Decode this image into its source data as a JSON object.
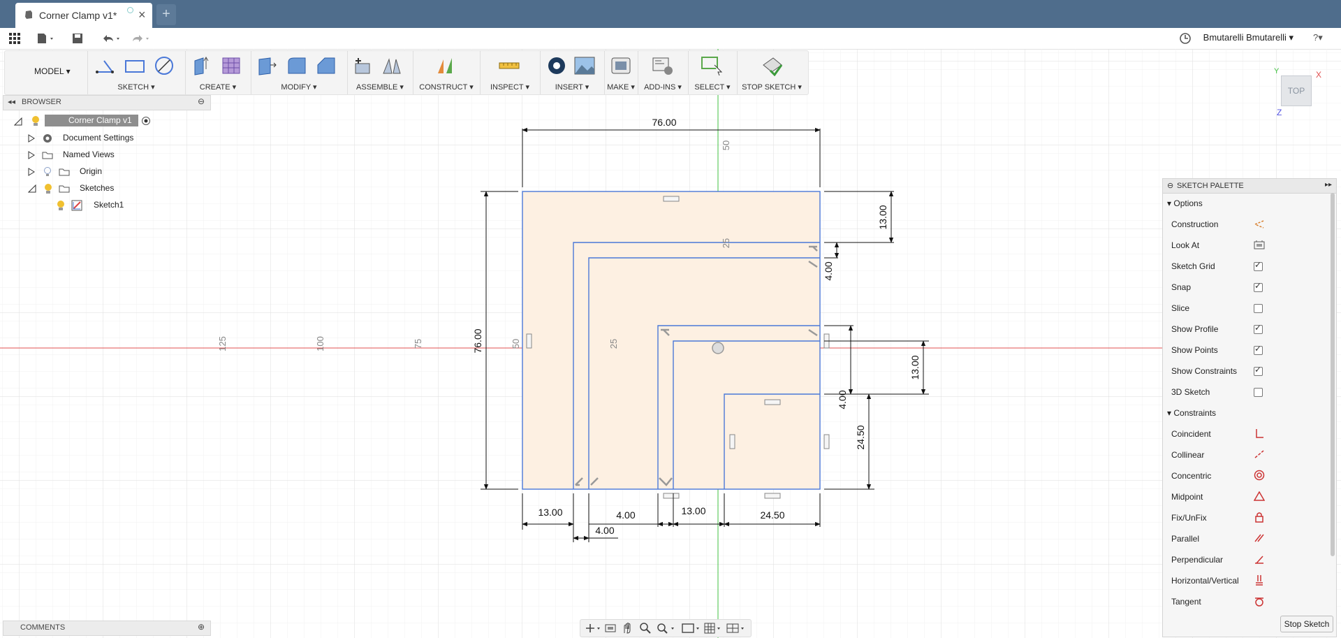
{
  "tab": {
    "title": "Corner Clamp v1*",
    "new_tab": "+"
  },
  "user": {
    "name": "Bmutarelli Bmutarelli ▾",
    "help": "?▾"
  },
  "toolbar": {
    "workspace": "MODEL ▾",
    "groups": [
      "SKETCH ▾",
      "CREATE ▾",
      "MODIFY ▾",
      "ASSEMBLE ▾",
      "CONSTRUCT ▾",
      "INSPECT ▾",
      "INSERT ▾",
      "MAKE ▾",
      "ADD-INS ▾",
      "SELECT ▾",
      "STOP SKETCH ▾"
    ]
  },
  "browser": {
    "title": "BROWSER",
    "root": "Corner Clamp v1",
    "items": [
      "Document Settings",
      "Named Views",
      "Origin",
      "Sketches",
      "Sketch1"
    ]
  },
  "viewcube": {
    "face": "TOP",
    "x": "X",
    "y": "Y",
    "z": "Z"
  },
  "canvas": {
    "axis_numbers": [
      "125",
      "100",
      "75",
      "50",
      "25",
      "50",
      "25"
    ],
    "dimensions": [
      "76.00",
      "76.00",
      "13.00",
      "4.00",
      "13.00",
      "4.00",
      "24.50",
      "13.00",
      "4.00",
      "4.00",
      "13.00",
      "24.50"
    ]
  },
  "palette": {
    "title": "SKETCH PALETTE",
    "options_header": "Options",
    "options": [
      {
        "label": "Construction",
        "checked": null,
        "icon": "construction-icon"
      },
      {
        "label": "Look At",
        "checked": null,
        "icon": "look-at-icon"
      },
      {
        "label": "Sketch Grid",
        "checked": true
      },
      {
        "label": "Snap",
        "checked": true
      },
      {
        "label": "Slice",
        "checked": false
      },
      {
        "label": "Show Profile",
        "checked": true
      },
      {
        "label": "Show Points",
        "checked": true
      },
      {
        "label": "Show Constraints",
        "checked": true
      },
      {
        "label": "3D Sketch",
        "checked": false
      }
    ],
    "constraints_header": "Constraints",
    "constraints": [
      "Coincident",
      "Collinear",
      "Concentric",
      "Midpoint",
      "Fix/UnFix",
      "Parallel",
      "Perpendicular",
      "Horizontal/Vertical",
      "Tangent"
    ],
    "stop_button": "Stop Sketch"
  },
  "comments": {
    "title": "COMMENTS"
  },
  "colors": {
    "titlebar": "#4f6d8c",
    "sketch_line": "#4a78d8",
    "profile_fill": "#fdf0e2",
    "x_axis": "#e05050",
    "y_axis": "#40c040"
  }
}
